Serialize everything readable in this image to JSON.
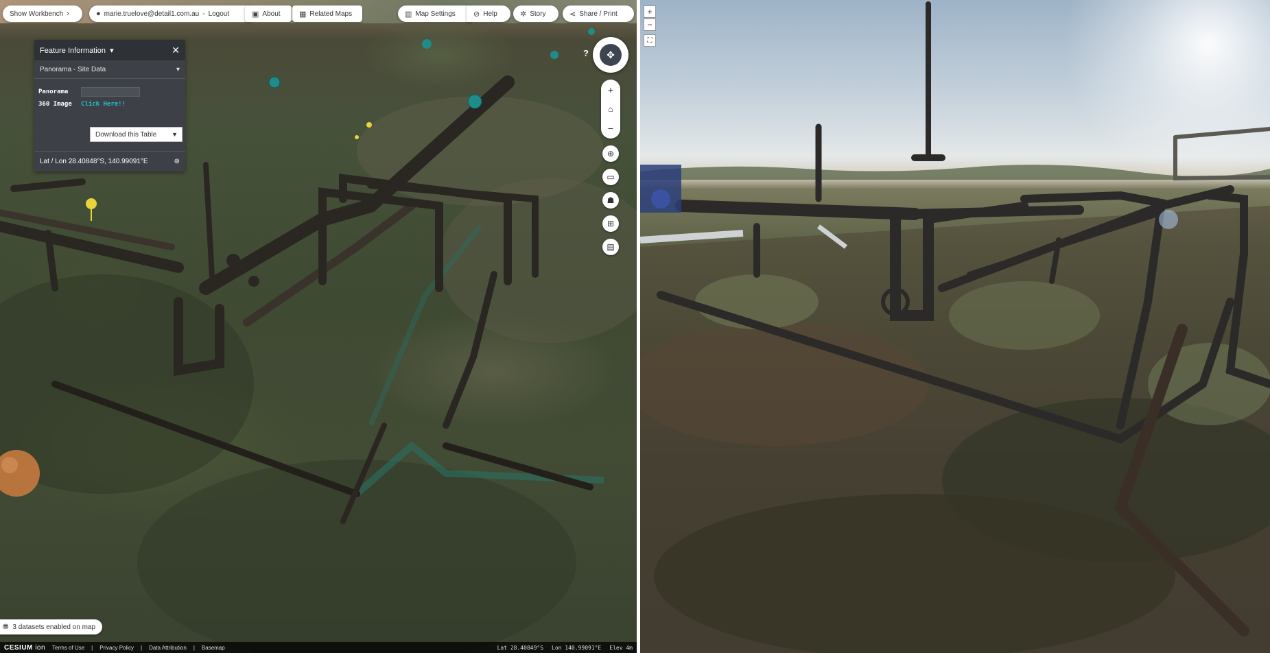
{
  "topbar": {
    "show_workbench": "Show Workbench",
    "user": "marie.truelove@detail1.com.au",
    "logout": "Logout",
    "about": "About",
    "related_maps": "Related Maps",
    "map_settings": "Map Settings",
    "help": "Help",
    "story": "Story",
    "share_print": "Share / Print"
  },
  "feature_panel": {
    "title": "Feature Information",
    "dataset": "Panorama - Site Data",
    "rows": [
      {
        "key": "Panorama",
        "value": ""
      },
      {
        "key": "360 Image",
        "value": "Click Here!!"
      }
    ],
    "download": "Download this Table",
    "latlon": "Lat / Lon 28.40848°S, 140.99091°E"
  },
  "map_controls": {
    "help": "?",
    "zoom_in": "+",
    "zoom_out": "−"
  },
  "footer": {
    "datasets": "3 datasets enabled on map",
    "cesium": "CESIUM",
    "cesium_suffix": "ion",
    "links": [
      "Terms of Use",
      "Privacy Policy",
      "Data Attribution",
      "Basemap"
    ],
    "lat": "Lat  28.40849°S",
    "lon": "Lon  140.99091°E",
    "elev": "Elev  4m"
  },
  "pano_controls": {
    "zoom_in": "+",
    "zoom_out": "−",
    "fullscreen": "⛶"
  },
  "icons": {
    "user": "user-icon",
    "about": "info-icon",
    "related_maps": "grid-icon",
    "map_settings": "map-settings-icon",
    "help": "help-icon",
    "story": "story-icon",
    "share": "share-icon",
    "close": "close-icon",
    "chevron": "chevron-down-icon",
    "compass": "compass-icon",
    "home": "home-icon",
    "locate": "locate-icon",
    "split": "split-view-icon",
    "pedestrian": "pedestrian-icon",
    "measure": "measure-icon",
    "print": "print-icon",
    "layers": "layers-icon"
  }
}
